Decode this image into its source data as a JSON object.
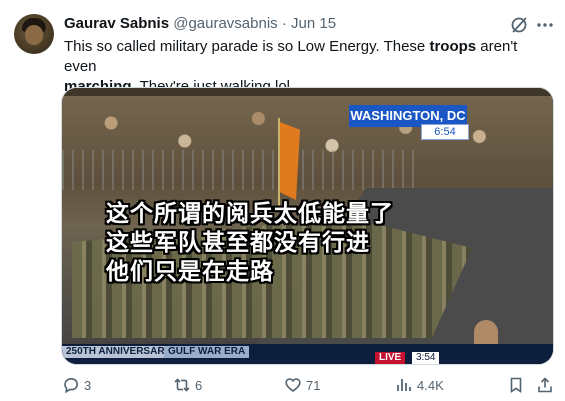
{
  "post": {
    "author_name": "Gaurav Sabnis",
    "handle": "@gauravsabnis",
    "separator": "·",
    "date": "Jun 15",
    "text_parts": {
      "p1": "This so called military parade is so Low Energy. These ",
      "p2": "troops",
      "p3": " aren't even ",
      "p4": "marching",
      "p5": ". They're just walking lol."
    }
  },
  "media": {
    "location_tag": "WASHINGTON, DC",
    "time_tag": "6:54",
    "subtitle_lines": [
      "这个所谓的阅兵太低能量了",
      "这些军队甚至都没有行进",
      "他们只是在走路"
    ],
    "anniversary_label": "250TH ANNIVERSARY",
    "event_label": "GULF WAR ERA",
    "live_label": "LIVE",
    "live_time": "3:54"
  },
  "actions": {
    "replies": "3",
    "reposts": "6",
    "likes": "71",
    "views": "4.4K"
  },
  "icons": [
    "grok-icon",
    "more-icon",
    "reply-icon",
    "repost-icon",
    "like-icon",
    "views-icon",
    "bookmark-icon",
    "share-icon"
  ]
}
